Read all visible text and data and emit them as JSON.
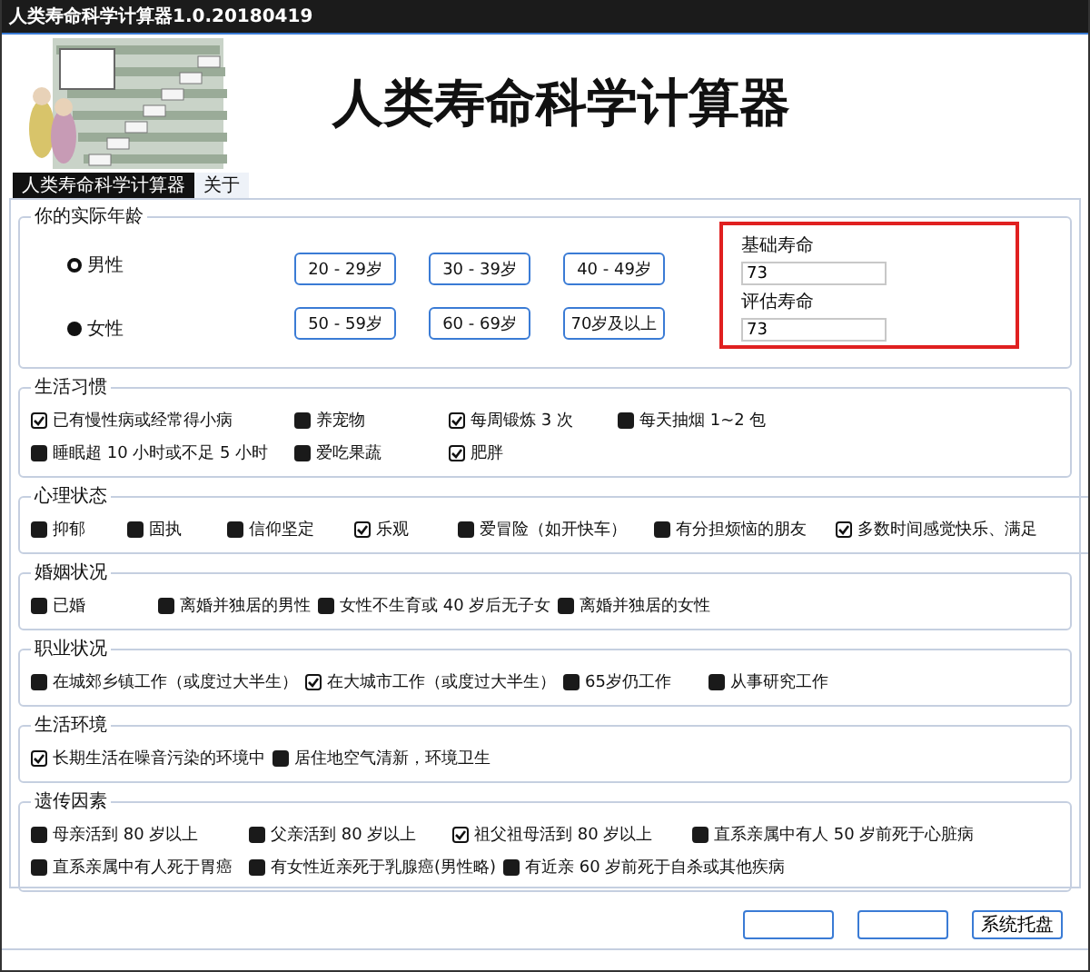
{
  "window": {
    "title": "人类寿命科学计算器1.0.20180419"
  },
  "header": {
    "title": "人类寿命科学计算器"
  },
  "tabs": [
    {
      "label": "人类寿命科学计算器",
      "selected": true
    },
    {
      "label": "关于",
      "selected": false
    }
  ],
  "age": {
    "legend": "你的实际年龄",
    "genders": [
      {
        "label": "男性",
        "selected": true
      },
      {
        "label": "女性",
        "selected": false
      }
    ],
    "age_buttons": [
      [
        "20 - 29岁",
        "30 - 39岁",
        "40 - 49岁"
      ],
      [
        "50 - 59岁",
        "60 - 69岁",
        "70岁及以上"
      ]
    ],
    "results": [
      {
        "label": "基础寿命",
        "value": "73"
      },
      {
        "label": "评估寿命",
        "value": "73"
      }
    ]
  },
  "sections": [
    {
      "legend": "生活习惯",
      "rows": [
        [
          {
            "label": "已有慢性病或经常得小病",
            "checked": true
          },
          {
            "label": "养宠物",
            "checked": false
          },
          {
            "label": "每周锻炼 3 次",
            "checked": true
          },
          {
            "label": "每天抽烟 1~2 包",
            "checked": false
          }
        ],
        [
          {
            "label": "睡眠超 10 小时或不足 5 小时",
            "checked": false
          },
          {
            "label": "爱吃果蔬",
            "checked": false
          },
          {
            "label": "肥胖",
            "checked": true
          }
        ]
      ]
    },
    {
      "legend": "心理状态",
      "rows": [
        [
          {
            "label": "抑郁",
            "checked": false
          },
          {
            "label": "固执",
            "checked": false
          },
          {
            "label": "信仰坚定",
            "checked": false
          },
          {
            "label": "乐观",
            "checked": true
          },
          {
            "label": "爱冒险（如开快车）",
            "checked": false
          },
          {
            "label": "有分担烦恼的朋友",
            "checked": false
          },
          {
            "label": "多数时间感觉快乐、满足",
            "checked": true
          }
        ]
      ]
    },
    {
      "legend": "婚姻状况",
      "rows": [
        [
          {
            "label": "已婚",
            "checked": false
          },
          {
            "label": "离婚并独居的男性",
            "checked": false
          },
          {
            "label": "女性不生育或 40 岁后无子女",
            "checked": false
          },
          {
            "label": "离婚并独居的女性",
            "checked": false
          }
        ]
      ]
    },
    {
      "legend": "职业状况",
      "rows": [
        [
          {
            "label": "在城郊乡镇工作（或度过大半生）",
            "checked": false
          },
          {
            "label": "在大城市工作（或度过大半生）",
            "checked": true
          },
          {
            "label": "65岁仍工作",
            "checked": false
          },
          {
            "label": "从事研究工作",
            "checked": false
          }
        ]
      ]
    },
    {
      "legend": "生活环境",
      "rows": [
        [
          {
            "label": "长期生活在噪音污染的环境中",
            "checked": true
          },
          {
            "label": "居住地空气清新，环境卫生",
            "checked": false
          }
        ]
      ]
    },
    {
      "legend": "遗传因素",
      "rows": [
        [
          {
            "label": "母亲活到 80 岁以上",
            "checked": false
          },
          {
            "label": "父亲活到 80 岁以上",
            "checked": false
          },
          {
            "label": "祖父祖母活到 80 岁以上",
            "checked": true
          },
          {
            "label": "直系亲属中有人 50 岁前死于心脏病",
            "checked": false
          }
        ],
        [
          {
            "label": "直系亲属中有人死于胃癌",
            "checked": false
          },
          {
            "label": "有女性近亲死于乳腺癌(男性略)",
            "checked": false
          },
          {
            "label": "有近亲 60 岁前死于自杀或其他疾病",
            "checked": false
          }
        ]
      ]
    }
  ],
  "buttons": [
    {
      "kind": "button"
    },
    {
      "kind": "button"
    },
    {
      "kind": "button",
      "label": "系统托盘"
    }
  ]
}
